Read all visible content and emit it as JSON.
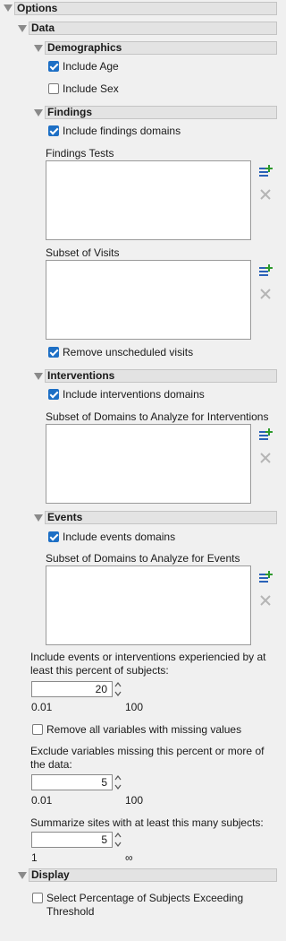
{
  "options": {
    "title": "Options"
  },
  "data_section": {
    "title": "Data"
  },
  "demographics": {
    "title": "Demographics",
    "include_age": {
      "label": "Include Age",
      "checked": true
    },
    "include_sex": {
      "label": "Include Sex",
      "checked": false
    }
  },
  "findings": {
    "title": "Findings",
    "include_domains": {
      "label": "Include findings domains",
      "checked": true
    },
    "tests_label": "Findings Tests",
    "visits_label": "Subset of Visits",
    "remove_unscheduled": {
      "label": "Remove unscheduled visits",
      "checked": true
    }
  },
  "interventions": {
    "title": "Interventions",
    "include_domains": {
      "label": "Include interventions domains",
      "checked": true
    },
    "subset_label": "Subset of Domains to Analyze for Interventions"
  },
  "events": {
    "title": "Events",
    "include_domains": {
      "label": "Include events domains",
      "checked": true
    },
    "subset_label": "Subset of Domains to Analyze for Events"
  },
  "threshold": {
    "label": "Include events or interventions experiencied by at least this percent of subjects:",
    "value": "20",
    "min": "0.01",
    "max": "100"
  },
  "remove_missing": {
    "label": "Remove all variables with missing values",
    "checked": false
  },
  "exclude_missing": {
    "label": "Exclude variables missing this percent or more of the data:",
    "value": "5",
    "min": "0.01",
    "max": "100"
  },
  "summarize_sites": {
    "label": "Summarize sites with at least this many subjects:",
    "value": "5",
    "min": "1",
    "max": "∞"
  },
  "display": {
    "title": "Display",
    "select_percentage": {
      "label": "Select Percentage of Subjects Exceeding Threshold",
      "checked": false
    }
  },
  "icons": {
    "add": "add-list-icon",
    "remove": "remove-x-icon"
  },
  "colors": {
    "check_blue": "#1d6fc5",
    "header_bg": "#e3e3e3",
    "add_green": "#2e9a2e",
    "add_blue": "#2a62b8"
  }
}
